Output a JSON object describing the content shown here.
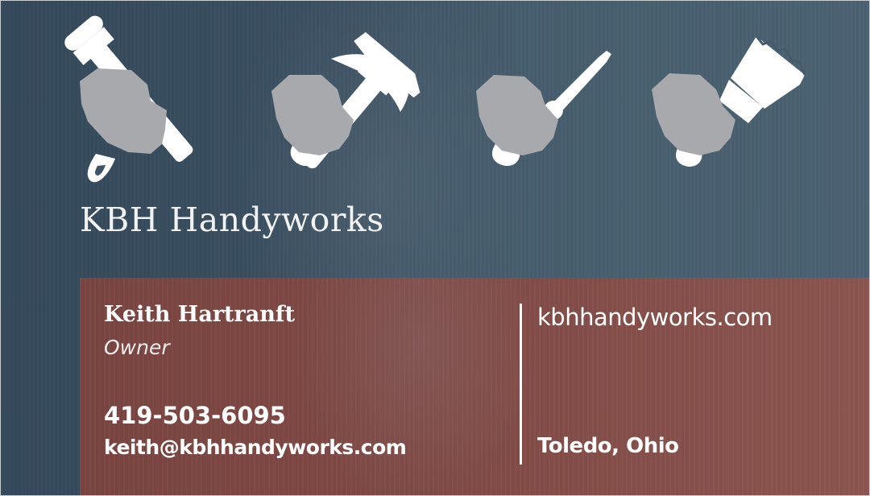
{
  "card": {
    "company_name": "KBH Handyworks",
    "contact": {
      "name": "Keith Hartranft",
      "title": "Owner",
      "phone": "419-503-6095",
      "email": "keith@kbhhandyworks.com",
      "website": "kbhhandyworks.com",
      "location": "Toledo, Ohio"
    },
    "icons": [
      "hand-wrench-icon",
      "hand-hammer-icon",
      "hand-screwdriver-icon",
      "hand-paintbrush-icon"
    ]
  },
  "colors": {
    "background": "#3a4f60",
    "panel": "#7f4843",
    "icon_glove": "#a7a9ac",
    "icon_tool": "#ffffff",
    "text": "#ffffff"
  }
}
